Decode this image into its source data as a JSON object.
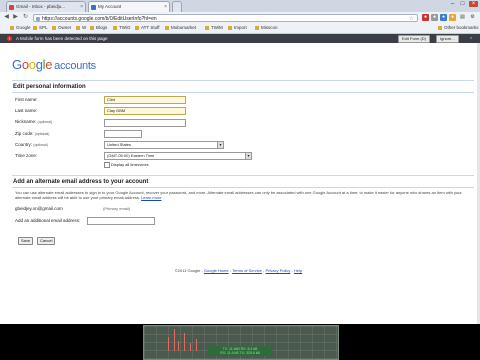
{
  "browser": {
    "tabs": [
      {
        "label": "Gmail - Inbox - pbeidju...",
        "icon_color": "#d44638"
      },
      {
        "label": "My Account",
        "icon_color": "#3d6ec9"
      }
    ],
    "address": "https://accounts.google.com/b/0/EditUserInfo?hl=en",
    "bookmarks": [
      "Google",
      "SPL",
      "Owner",
      "W",
      "Blogs",
      "TWiG",
      "ATT Stuff",
      "Mobomarket",
      "TWiM",
      "Import",
      "Misscon"
    ],
    "other_bookmarks": "Other bookmarks",
    "infobar": {
      "message": "A Mobile form has been detected on this page",
      "btn1": "Edit Form (D)",
      "btn2": "Ignore..."
    }
  },
  "logo": {
    "google": "Google",
    "accounts": "accounts"
  },
  "edit_section": {
    "title": "Edit personal information",
    "first_name": {
      "label": "First name:",
      "value": "Clint"
    },
    "last_name": {
      "label": "Last name:",
      "value": "Clay GBM"
    },
    "nickname": {
      "label": "Nickname:",
      "optional": "(optional)",
      "value": ""
    },
    "zip": {
      "label": "Zip code:",
      "optional": "(optional)",
      "value": ""
    },
    "country": {
      "label": "Country:",
      "optional": "(optional)",
      "value": "United States"
    },
    "timezone": {
      "label": "Time zone:",
      "value": "(GMT-05:00) Eastern Time"
    },
    "display_all": "Display all timezones"
  },
  "email_section": {
    "title": "Add an alternate email address to your account",
    "description": "You can use alternate email addresses to sign in to your Google Account, recover your password, and more. Alternate email addresses can only be associated with one Google Account at a time; to make it easier for anyone who shares an item with your alternate email address will be able to use your primary email address.",
    "learn_more": "Learn more",
    "current_email": "gbeidjey.on@gmail.com",
    "primary_label": "(Primary email)",
    "add_label": "Add an additional email address:",
    "add_value": ""
  },
  "buttons": {
    "save": "Save",
    "cancel": "Cancel"
  },
  "footer": {
    "copyright": "©2011 Google",
    "links": [
      "Google Home",
      "Terms of Service",
      "Privacy Policy",
      "Help"
    ]
  },
  "overlay": {
    "line1": "TX: 11.4kB  RX: 8.4 kB",
    "line2": "RX: 11.6 kB  TX: 325.8 kB"
  }
}
